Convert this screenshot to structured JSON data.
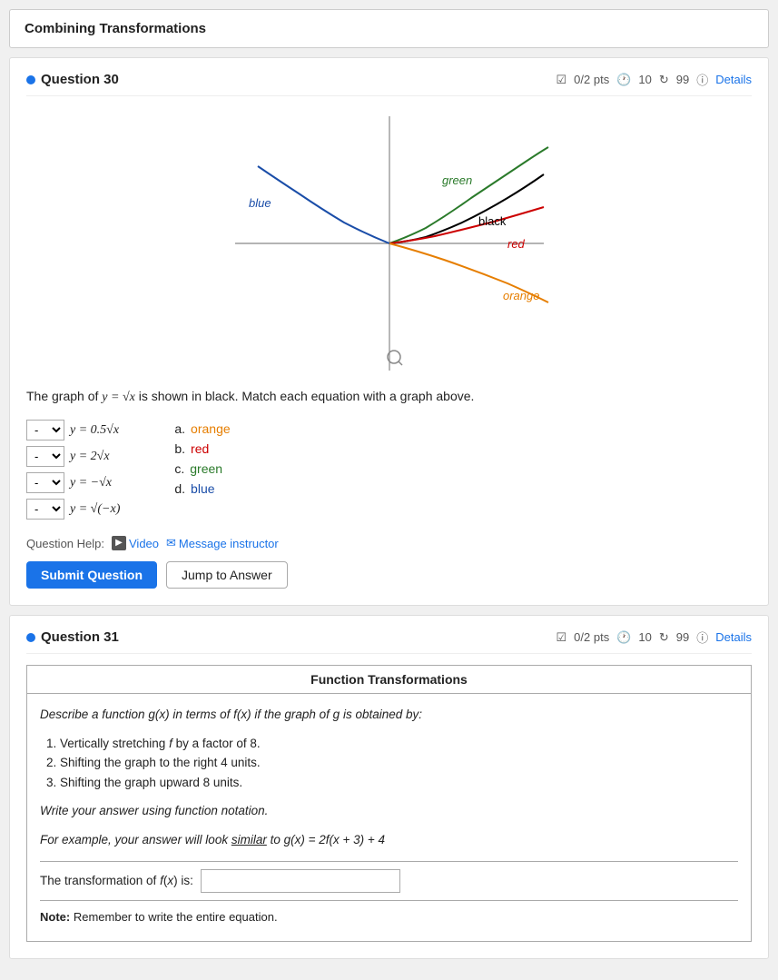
{
  "page": {
    "section_title": "Combining Transformations",
    "question30": {
      "label": "Question 30",
      "pts": "0/2 pts",
      "timer": "10",
      "retry": "99",
      "details": "Details",
      "graph_description": "The graph of y = √x is shown in black. Match each equation with a graph above.",
      "equations": [
        {
          "id": "a",
          "eq_html": "y = 0.5√x",
          "option_letter": "a.",
          "option_label": "orange",
          "option_color": "orange"
        },
        {
          "id": "b",
          "eq_html": "y = 2√x",
          "option_letter": "b.",
          "option_label": "red",
          "option_color": "red"
        },
        {
          "id": "c",
          "eq_html": "y = −√x",
          "option_letter": "c.",
          "option_label": "green",
          "option_color": "green"
        },
        {
          "id": "d",
          "eq_html": "y = √(−x)",
          "option_letter": "d.",
          "option_label": "blue",
          "option_color": "blue"
        }
      ],
      "help_label": "Question Help:",
      "video_label": "Video",
      "message_label": "Message instructor",
      "submit_label": "Submit Question",
      "jump_label": "Jump to Answer"
    },
    "question31": {
      "label": "Question 31",
      "pts": "0/2 pts",
      "timer": "10",
      "retry": "99",
      "details": "Details",
      "box_title": "Function Transformations",
      "describe": "Describe a function g(x) in terms of f(x) if the graph of g is obtained by:",
      "steps": [
        "Vertically stretching f by a factor of 8.",
        "Shifting the graph to the right 4 units.",
        "Shifting the graph upward 8 units."
      ],
      "write_answer": "Write your answer using function notation.",
      "example": "For example, your answer will look similar to g(x) = 2f(x + 3) + 4",
      "transform_label": "The transformation of f(x) is:",
      "transform_placeholder": "",
      "note": "Note: Remember to write the entire equation."
    }
  }
}
